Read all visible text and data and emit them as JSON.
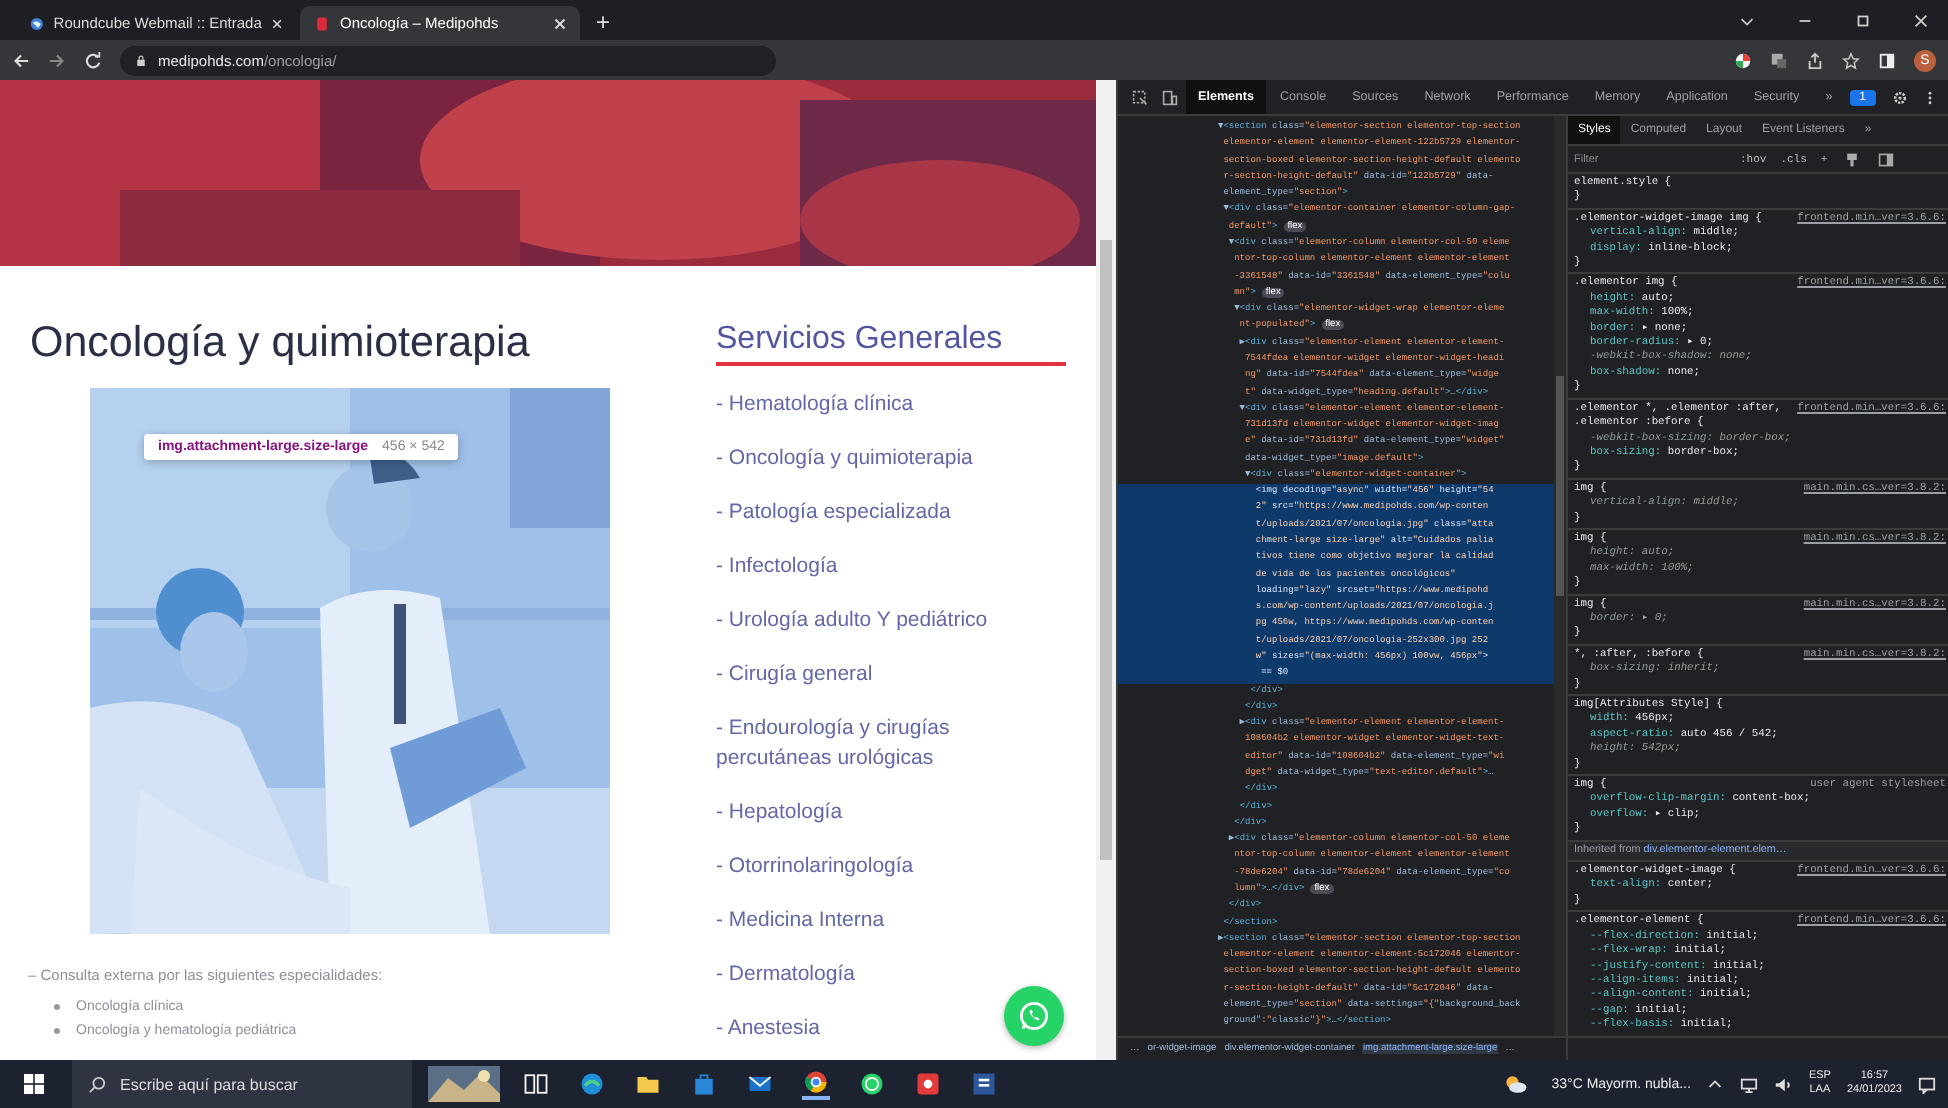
{
  "browser": {
    "tabs": [
      {
        "title": "Roundcube Webmail :: Entrada",
        "selected": false
      },
      {
        "title": "Oncología – Medipohds",
        "selected": true
      }
    ],
    "new_tab": "+",
    "url": {
      "host": "medipohds.com",
      "path": "/oncologia/"
    },
    "profile_initial": "S"
  },
  "page": {
    "title": "Oncología y quimioterapia",
    "inspect_tooltip": {
      "selector": "img.attachment-large.size-large",
      "size": "456 × 542"
    },
    "sidebar": {
      "title": "Servicios Generales",
      "items": [
        "- Hematología clínica",
        "- Oncología y quimioterapia",
        "- Patología especializada",
        "- Infectología",
        "- Urología adulto Y pediátrico",
        "- Cirugía general",
        "- Endourología y cirugías percutáneas urológicas",
        "- Hepatología",
        "- Otorrinolaringología",
        "- Medicina Interna",
        "- Dermatología",
        "- Anestesia"
      ]
    },
    "intro": "– Consulta externa por las siguientes especialidades:",
    "bullets": [
      "Oncología clínica",
      "Oncología y hematología pediátrica"
    ]
  },
  "devtools": {
    "tabs": [
      {
        "label": "Elements",
        "selected": true
      },
      {
        "label": "Console",
        "selected": false
      },
      {
        "label": "Sources",
        "selected": false
      },
      {
        "label": "Network",
        "selected": false
      },
      {
        "label": "Performance",
        "selected": false
      },
      {
        "label": "Memory",
        "selected": false
      },
      {
        "label": "Application",
        "selected": false
      },
      {
        "label": "Security",
        "selected": false
      }
    ],
    "more": "»",
    "issues_count": "1",
    "dom_lines": [
      {
        "text": "▼<section class=\"elementor-section elementor-top-section",
        "selected": false
      },
      {
        "text": " elementor-element elementor-element-122b5729 elementor-",
        "selected": false
      },
      {
        "text": " section-boxed elementor-section-height-default elemento",
        "selected": false
      },
      {
        "text": " r-section-height-default\" data-id=\"122b5729\" data-",
        "selected": false
      },
      {
        "text": " element_type=\"section\">",
        "selected": false
      },
      {
        "text": " ▼<div class=\"elementor-container elementor-column-gap-",
        "selected": false
      },
      {
        "text": "  default\">",
        "selected": false,
        "badge": "flex"
      },
      {
        "text": "  ▼<div class=\"elementor-column elementor-col-50 eleme",
        "selected": false
      },
      {
        "text": "   ntor-top-column elementor-element elementor-element",
        "selected": false
      },
      {
        "text": "   -3361548\" data-id=\"3361548\" data-element_type=\"colu",
        "selected": false
      },
      {
        "text": "   mn\">",
        "selected": false,
        "badge": "flex"
      },
      {
        "text": "   ▼<div class=\"elementor-widget-wrap elementor-eleme",
        "selected": false
      },
      {
        "text": "    nt-populated\">",
        "selected": false,
        "badge": "flex"
      },
      {
        "text": "    ▶<div class=\"elementor-element elementor-element-",
        "selected": false
      },
      {
        "text": "     7544fdea elementor-widget elementor-widget-headi",
        "selected": false
      },
      {
        "text": "     ng\" data-id=\"7544fdea\" data-element_type=\"widge",
        "selected": false
      },
      {
        "text": "     t\" data-widget_type=\"heading.default\">…</div>",
        "selected": false
      },
      {
        "text": "    ▼<div class=\"elementor-element elementor-element-",
        "selected": false
      },
      {
        "text": "     731d13fd elementor-widget elementor-widget-imag",
        "selected": false
      },
      {
        "text": "     e\" data-id=\"731d13fd\" data-element_type=\"widget\"",
        "selected": false
      },
      {
        "text": "     data-widget_type=\"image.default\">",
        "selected": false
      },
      {
        "text": "     ▼<div class=\"elementor-widget-container\">",
        "selected": false
      },
      {
        "text": "       <img decoding=\"async\" width=\"456\" height=\"54",
        "selected": true
      },
      {
        "text": "       2\" src=\"https://www.medipohds.com/wp-conten",
        "selected": true
      },
      {
        "text": "       t/uploads/2021/07/oncologia.jpg\" class=\"atta",
        "selected": true
      },
      {
        "text": "       chment-large size-large\" alt=\"Cuidados palia",
        "selected": true
      },
      {
        "text": "       tivos tiene como objetivo mejorar la calidad",
        "selected": true
      },
      {
        "text": "       de vida de los pacientes oncológicos\"",
        "selected": true
      },
      {
        "text": "       loading=\"lazy\" srcset=\"https://www.medipohd",
        "selected": true
      },
      {
        "text": "       s.com/wp-content/uploads/2021/07/oncologia.j",
        "selected": true
      },
      {
        "text": "       pg 456w, https://www.medipohds.com/wp-conten",
        "selected": true
      },
      {
        "text": "       t/uploads/2021/07/oncologia-252x300.jpg 252",
        "selected": true
      },
      {
        "text": "       w\" sizes=\"(max-width: 456px) 100vw, 456px\">",
        "selected": true
      },
      {
        "text": "        == $0",
        "selected": true
      },
      {
        "text": "      </div>",
        "selected": false
      },
      {
        "text": "     </div>",
        "selected": false
      },
      {
        "text": "    ▶<div class=\"elementor-element elementor-element-",
        "selected": false
      },
      {
        "text": "     108604b2 elementor-widget elementor-widget-text-",
        "selected": false
      },
      {
        "text": "     editor\" data-id=\"108604b2\" data-element_type=\"wi",
        "selected": false
      },
      {
        "text": "     dget\" data-widget_type=\"text-editor.default\">…",
        "selected": false
      },
      {
        "text": "     </div>",
        "selected": false
      },
      {
        "text": "    </div>",
        "selected": false
      },
      {
        "text": "   </div>",
        "selected": false
      },
      {
        "text": "  ▶<div class=\"elementor-column elementor-col-50 eleme",
        "selected": false
      },
      {
        "text": "   ntor-top-column elementor-element elementor-element",
        "selected": false
      },
      {
        "text": "   -78de6204\" data-id=\"78de6204\" data-element_type=\"co",
        "selected": false
      },
      {
        "text": "   lumn\">…</div>",
        "selected": false,
        "badge": "flex"
      },
      {
        "text": "  </div>",
        "selected": false
      },
      {
        "text": " </section>",
        "selected": false
      },
      {
        "text": "▶<section class=\"elementor-section elementor-top-section",
        "selected": false
      },
      {
        "text": " elementor-element elementor-element-5c172046 elementor-",
        "selected": false
      },
      {
        "text": " section-boxed elementor-section-height-default elemento",
        "selected": false
      },
      {
        "text": " r-section-height-default\" data-id=\"5c172046\" data-",
        "selected": false
      },
      {
        "text": " element_type=\"section\" data-settings=\"{\"background_back",
        "selected": false
      },
      {
        "text": " ground\":\"classic\"}\">…</section>",
        "selected": false
      }
    ],
    "breadcrumbs": [
      "…",
      "or-widget-image",
      "div.elementor-widget-container",
      "img.attachment-large.size-large",
      "…"
    ],
    "styles_tabs": [
      {
        "label": "Styles",
        "selected": true
      },
      {
        "label": "Computed",
        "selected": false
      },
      {
        "label": "Layout",
        "selected": false
      },
      {
        "label": "Event Listeners",
        "selected": false
      }
    ],
    "styles_more": "»",
    "filter_placeholder": "Filter",
    "hov": ":hov",
    "cls": ".cls",
    "add": "+",
    "rules": [
      {
        "kind": "rule",
        "selector": "element.style {",
        "close": "}"
      },
      {
        "kind": "rule",
        "selector": ".elementor-widget-image img {",
        "source": "frontend.min…ver=3.6.6:",
        "close": "}",
        "declarations": [
          {
            "prop": "vertical-align:",
            "value": "middle;",
            "struck": false
          },
          {
            "prop": "display:",
            "value": "inline-block;",
            "struck": false
          }
        ]
      },
      {
        "kind": "rule",
        "selector": ".elementor img {",
        "source": "frontend.min…ver=3.6.6:",
        "close": "}",
        "declarations": [
          {
            "prop": "height:",
            "value": "auto;",
            "struck": false
          },
          {
            "prop": "max-width:",
            "value": "100%;",
            "struck": false
          },
          {
            "prop": "border:",
            "value": "▸ none;",
            "struck": false
          },
          {
            "prop": "border-radius:",
            "value": "▸ 0;",
            "struck": false
          },
          {
            "prop": "-webkit-box-shadow:",
            "value": "none;",
            "struck": true
          },
          {
            "prop": "box-shadow:",
            "value": "none;",
            "struck": false
          }
        ]
      },
      {
        "kind": "rule",
        "selector": ".elementor *, .elementor :after, .elementor :before {",
        "source": "frontend.min…ver=3.6.6:",
        "close": "}",
        "declarations": [
          {
            "prop": "-webkit-box-sizing:",
            "value": "border-box;",
            "struck": true
          },
          {
            "prop": "box-sizing:",
            "value": "border-box;",
            "struck": false
          }
        ]
      },
      {
        "kind": "rule",
        "selector": "img {",
        "source": "main.min.cs…ver=3.8.2:",
        "close": "}",
        "declarations": [
          {
            "prop": "vertical-align:",
            "value": "middle;",
            "struck": true
          }
        ]
      },
      {
        "kind": "rule",
        "selector": "img {",
        "source": "main.min.cs…ver=3.8.2:",
        "close": "}",
        "declarations": [
          {
            "prop": "height:",
            "value": "auto;",
            "struck": true
          },
          {
            "prop": "max-width:",
            "value": "100%;",
            "struck": true
          }
        ]
      },
      {
        "kind": "rule",
        "selector": "img {",
        "source": "main.min.cs…ver=3.8.2:",
        "close": "}",
        "declarations": [
          {
            "prop": "border:",
            "value": "▸ 0;",
            "struck": true
          }
        ]
      },
      {
        "kind": "rule",
        "selector": "*, :after, :before {",
        "source": "main.min.cs…ver=3.8.2:",
        "close": "}",
        "declarations": [
          {
            "prop": "box-sizing:",
            "value": "inherit;",
            "struck": true
          }
        ]
      },
      {
        "kind": "rule",
        "selector": "img[Attributes Style] {",
        "close": "}",
        "declarations": [
          {
            "prop": "width:",
            "value": "456px;",
            "struck": false
          },
          {
            "prop": "aspect-ratio:",
            "value": "auto 456 / 542;",
            "struck": false
          },
          {
            "prop": "height:",
            "value": "542px;",
            "struck": true
          }
        ]
      },
      {
        "kind": "rule",
        "selector": "img {",
        "source": "user agent stylesheet",
        "close": "}",
        "declarations": [
          {
            "prop": "overflow-clip-margin:",
            "value": "content-box;",
            "struck": false
          },
          {
            "prop": "overflow:",
            "value": "▸ clip;",
            "struck": false
          }
        ]
      },
      {
        "kind": "heading",
        "text": "Inherited from",
        "link": "div.elementor-element.elem…"
      },
      {
        "kind": "rule",
        "selector": ".elementor-widget-image {",
        "source": "frontend.min…ver=3.6.6:",
        "close": "}",
        "declarations": [
          {
            "prop": "text-align:",
            "value": "center;",
            "struck": false
          }
        ]
      },
      {
        "kind": "rule",
        "selector": ".elementor-element {",
        "source": "frontend.min…ver=3.6.6:",
        "declarations": [
          {
            "prop": "--flex-direction:",
            "value": "initial;",
            "struck": false
          },
          {
            "prop": "--flex-wrap:",
            "value": "initial;",
            "struck": false
          },
          {
            "prop": "--justify-content:",
            "value": "initial;",
            "struck": false
          },
          {
            "prop": "--align-items:",
            "value": "initial;",
            "struck": false
          },
          {
            "prop": "--align-content:",
            "value": "initial;",
            "struck": false
          },
          {
            "prop": "--gap:",
            "value": "initial;",
            "struck": false
          },
          {
            "prop": "--flex-basis:",
            "value": "initial;",
            "struck": false
          }
        ]
      }
    ]
  },
  "taskbar": {
    "search_placeholder": "Escribe aquí para buscar",
    "weather": "33°C  Mayorm. nubla...",
    "lang": "ESP",
    "lang_sub": "LAA",
    "time": "16:57",
    "date": "24/01/2023"
  }
}
